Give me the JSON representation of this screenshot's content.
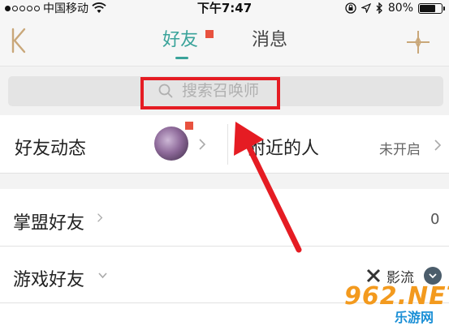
{
  "status_bar": {
    "carrier": "中国移动",
    "time": "下午7:47",
    "battery": "80%",
    "battery_level": 0.8
  },
  "nav": {
    "tabs": [
      {
        "label": "好友",
        "active": true,
        "badge": true
      },
      {
        "label": "消息",
        "active": false
      }
    ],
    "back_icon": "back-chevron-icon",
    "add_icon": "plus-icon"
  },
  "search": {
    "placeholder": "搜索召唤师"
  },
  "rows": {
    "friend_feed": "好友动态",
    "nearby": "附近的人",
    "nearby_status": "未开启",
    "league_friends": "掌盟好友",
    "league_friends_count": "0",
    "game_friends": "游戏好友",
    "game_name": "影流"
  },
  "watermark": {
    "main": "962.NET",
    "sub": "乐游网"
  },
  "colors": {
    "accent": "#3aa39a",
    "badge": "#e8523f",
    "highlight": "#e51c23"
  }
}
